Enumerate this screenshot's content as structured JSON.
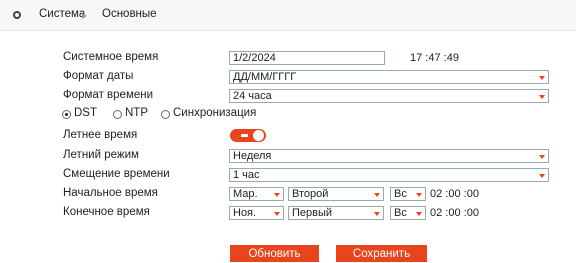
{
  "breadcrumb": {
    "root": "Система",
    "current": "Основные"
  },
  "system_time": {
    "label": "Системное время",
    "date_value": "1/2/2024",
    "clock": "17 :47 :49"
  },
  "date_format": {
    "label": "Формат даты",
    "value": "ДД/ММ/ГГГГ"
  },
  "time_format": {
    "label": "Формат времени",
    "value": "24 часа"
  },
  "sync_mode": {
    "options": [
      "DST",
      "NTP",
      "Синхронизация"
    ],
    "selected": "DST"
  },
  "dst_enabled": {
    "label": "Летнее время",
    "on": true
  },
  "dst_mode": {
    "label": "Летний режим",
    "value": "Неделя"
  },
  "time_offset": {
    "label": "Смещение времени",
    "value": "1 час"
  },
  "start_time": {
    "label": "Начальное время",
    "month": "Мар.",
    "week": "Второй",
    "day": "Вс",
    "time": "02 :00 :00"
  },
  "end_time": {
    "label": "Конечное время",
    "month": "Ноя.",
    "week": "Первый",
    "day": "Вс",
    "time": "02 :00 :00"
  },
  "buttons": {
    "refresh": "Обновить",
    "save": "Сохранить"
  },
  "colors": {
    "accent": "#e8451c"
  }
}
